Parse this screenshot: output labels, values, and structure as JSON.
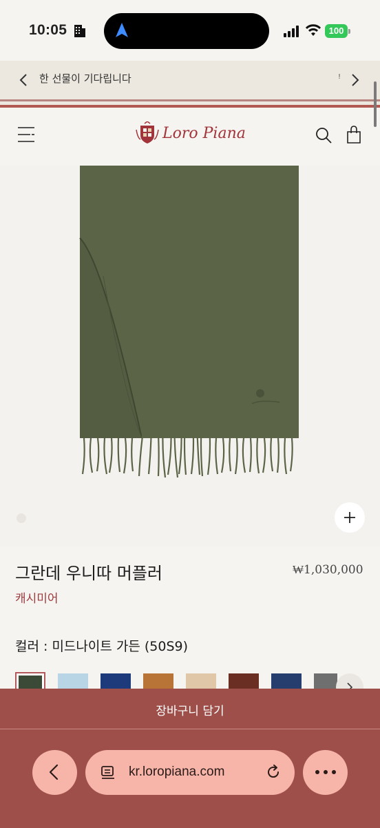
{
  "status_bar": {
    "time": "10:05",
    "battery": "100",
    "icons": [
      "building-icon",
      "location-arrow-icon",
      "signal-icon",
      "wifi-icon",
      "battery-icon"
    ]
  },
  "promo": {
    "text": "한 선물이 기다립니다",
    "tick": "!",
    "icons": [
      "chevron-left-icon",
      "chevron-right-icon"
    ]
  },
  "header": {
    "logo_text": "Loro Piana",
    "icons": [
      "menu-icon",
      "search-icon",
      "shopping-bag-icon"
    ]
  },
  "product": {
    "name": "그란데 우니따 머플러",
    "price": "₩1,030,000",
    "material": "캐시미어",
    "color_label": "컬러 : 미드나이트 가든 (50S9)",
    "image_color": "#5b6447"
  },
  "swatches": [
    {
      "color": "#3b4a37",
      "selected": true
    },
    {
      "color": "#b8d5e6",
      "selected": false
    },
    {
      "color": "#1d3a7a",
      "selected": false
    },
    {
      "color": "#b77436",
      "selected": false
    },
    {
      "color": "#e0c7a8",
      "selected": false
    },
    {
      "color": "#6a2f22",
      "selected": false
    },
    {
      "color": "#263e6e",
      "selected": false
    },
    {
      "color": "#6f6f6f",
      "selected": false
    }
  ],
  "cart": {
    "label": "장바구니 담기"
  },
  "browser": {
    "url": "kr.loropiana.com",
    "icons": [
      "back-icon",
      "tabs-icon",
      "reload-icon",
      "more-icon"
    ]
  },
  "colors": {
    "brand_red": "#a1343a",
    "cart_bar": "#9e4f4a",
    "browser_pill": "#f6b5a8"
  }
}
